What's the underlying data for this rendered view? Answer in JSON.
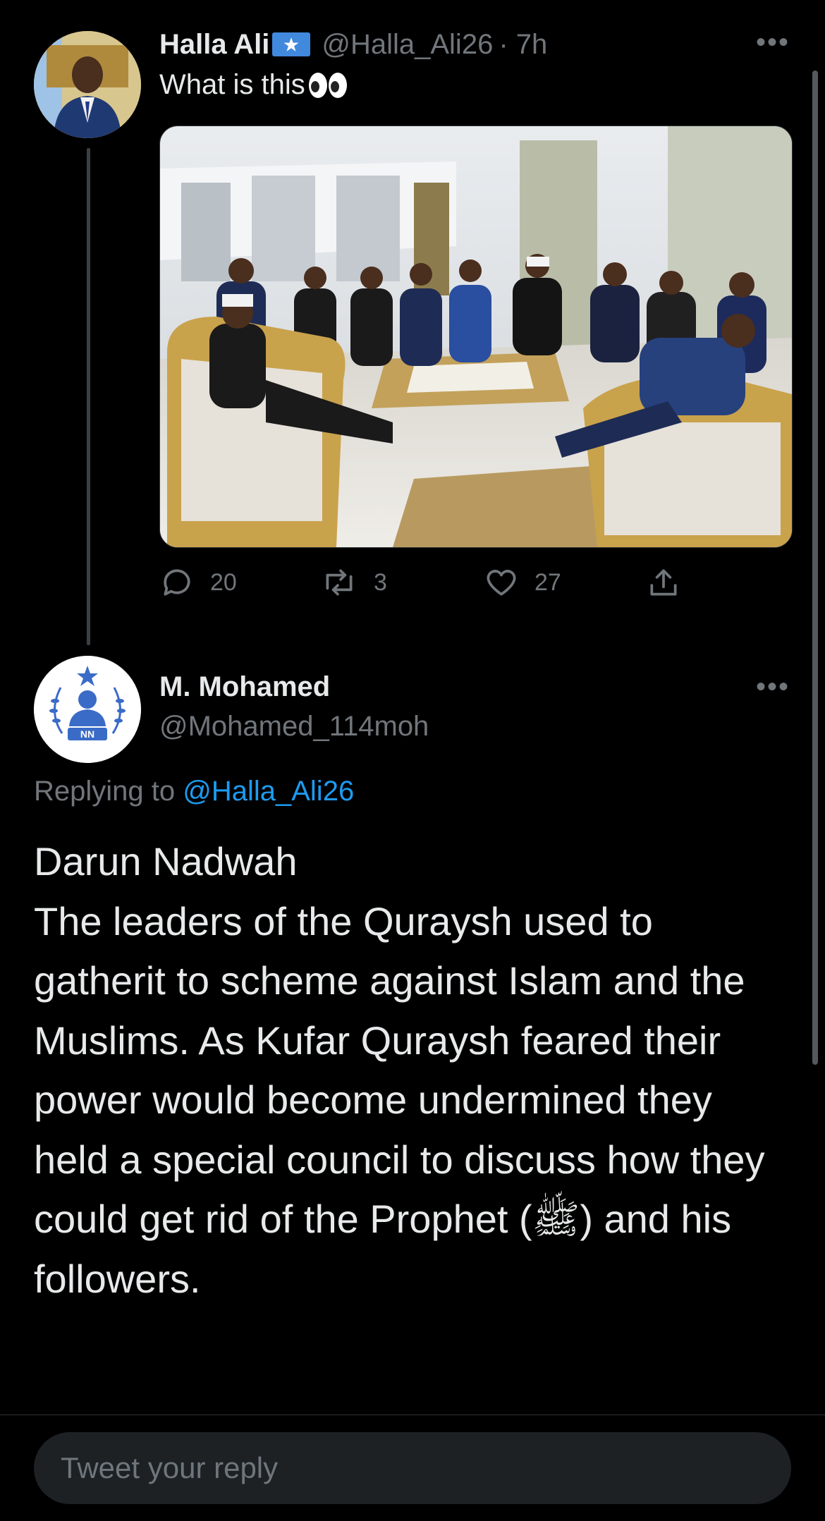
{
  "tweet1": {
    "display_name": "Halla Ali",
    "handle": "@Halla_Ali26",
    "time": "· 7h",
    "text": "What is this",
    "replies": "20",
    "retweets": "3",
    "likes": "27",
    "more_label": "•••"
  },
  "tweet2": {
    "display_name": "M. Mohamed",
    "handle": "@Mohamed_114moh",
    "replying_prefix": "Replying to ",
    "replying_handle": "@Halla_Ali26",
    "body": "Darun Nadwah\nThe leaders of the Quraysh used to gatherit to scheme against Islam and the Muslims. As Kufar Quraysh feared their power would become undermined they held a special council to discuss how they could get rid of the Prophet (ﷺ) and his followers.",
    "more_label": "•••"
  },
  "reply": {
    "placeholder": "Tweet your reply"
  },
  "colors": {
    "background": "#000000",
    "text": "#e7e9ea",
    "muted": "#71767b",
    "link": "#1d9bf0",
    "reply_box": "#1e2124"
  },
  "icons": [
    "reply-icon",
    "retweet-icon",
    "like-icon",
    "share-icon",
    "more-icon",
    "somali-flag-emoji",
    "eyes-emoji"
  ]
}
